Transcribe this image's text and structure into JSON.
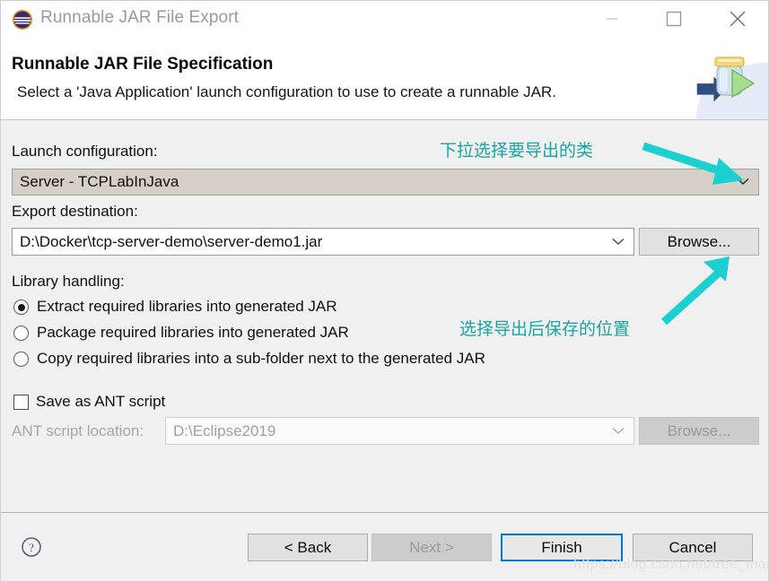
{
  "window": {
    "title": "Runnable JAR File Export",
    "icon": "eclipse-icon",
    "controls": {
      "minimize": "minimize-icon",
      "maximize": "maximize-icon",
      "close": "close-icon"
    }
  },
  "header": {
    "title": "Runnable JAR File Specification",
    "subtitle": "Select a 'Java Application' launch configuration to use to create a runnable JAR.",
    "graphic": "jar-export-icon"
  },
  "launch_configuration": {
    "label": "Launch configuration:",
    "value": "Server - TCPLabInJava",
    "chevron": "chevron-down-icon"
  },
  "export_destination": {
    "label": "Export destination:",
    "value": "D:\\Docker\\tcp-server-demo\\server-demo1.jar",
    "chevron": "chevron-down-icon",
    "browse_label": "Browse..."
  },
  "library_handling": {
    "label": "Library handling:",
    "options": [
      {
        "label": "Extract required libraries into generated JAR",
        "checked": true
      },
      {
        "label": "Package required libraries into generated JAR",
        "checked": false
      },
      {
        "label": "Copy required libraries into a sub-folder next to the generated JAR",
        "checked": false
      }
    ]
  },
  "ant": {
    "checkbox_label": "Save as ANT script",
    "checked": false,
    "location_label": "ANT script location:",
    "location_value": "D:\\Eclipse2019",
    "chevron": "chevron-down-icon",
    "browse_label": "Browse...",
    "disabled": true
  },
  "footer": {
    "help": "help-icon",
    "back_label": "< Back",
    "next_label": "Next >",
    "next_disabled": true,
    "finish_label": "Finish",
    "finish_default": true,
    "cancel_label": "Cancel"
  },
  "annotations": [
    {
      "text": "下拉选择要导出的类",
      "color": "#19a5a5"
    },
    {
      "text": "选择导出后保存的位置",
      "color": "#19a5a5"
    }
  ],
  "watermark": "https://blog.csdn.net/free_main",
  "colors": {
    "accent": "#0078d7",
    "annotation": "#19a5a5",
    "dialog_bg": "#f0f0f0",
    "header_bg": "#ffffff"
  }
}
